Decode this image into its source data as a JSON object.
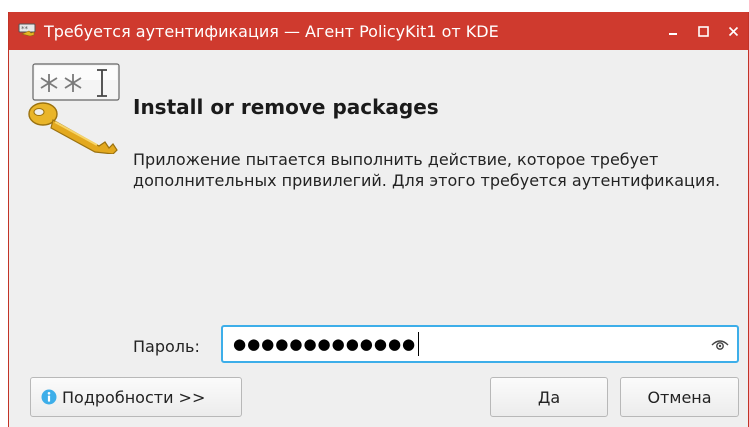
{
  "window": {
    "title": "Требуется аутентификация — Агент PolicyKit1 от KDE",
    "minimize_glyph": "_",
    "maximize_glyph": "□",
    "close_glyph": "×"
  },
  "dialog": {
    "heading": "Install or remove packages",
    "message": "Приложение пытается выполнить действие, которое требует дополнительных привилегий. Для этого требуется аутентификация.",
    "password_label": "Пароль:",
    "password_masked": "●●●●●●●●●●●●●"
  },
  "buttons": {
    "details": "Подробности >>",
    "ok": "Да",
    "cancel": "Отмена"
  },
  "icons": {
    "title": "password-prompt-icon",
    "dialog": "auth-key-icon",
    "reveal": "eye-icon",
    "details": "info-icon"
  },
  "colors": {
    "titlebar": "#cf3a2e",
    "focus_border": "#3daee9",
    "info": "#3daee9"
  }
}
